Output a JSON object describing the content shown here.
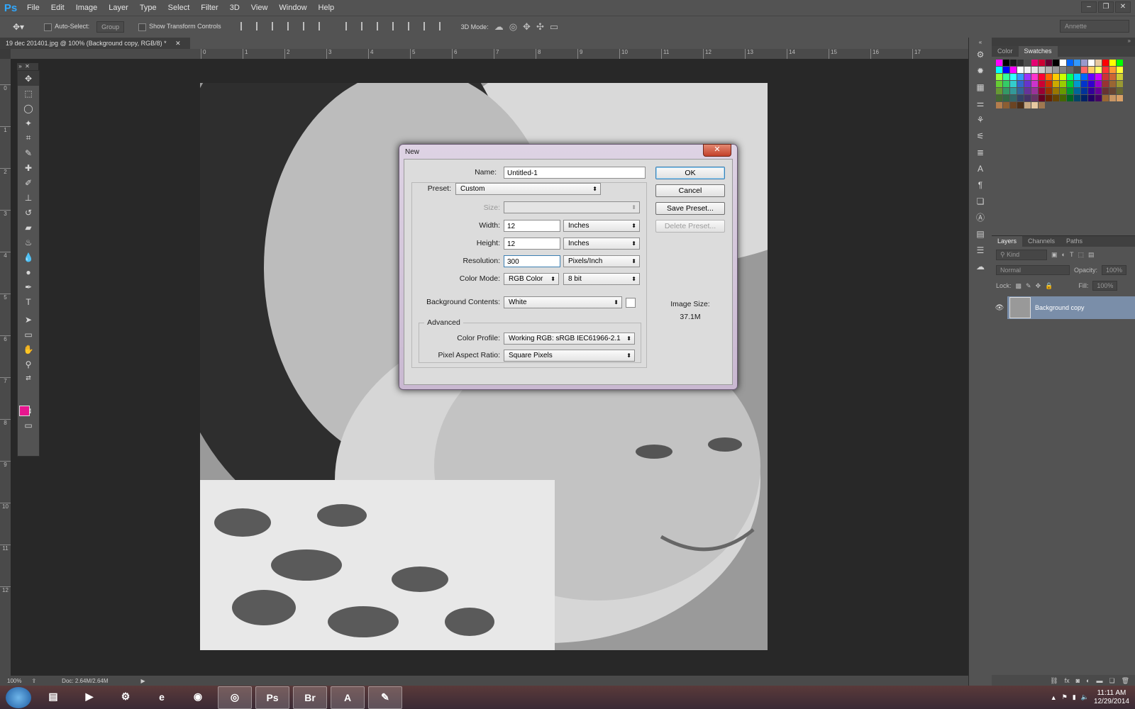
{
  "app": {
    "logo": "Ps"
  },
  "menu": [
    "File",
    "Edit",
    "Image",
    "Layer",
    "Type",
    "Select",
    "Filter",
    "3D",
    "View",
    "Window",
    "Help"
  ],
  "options": {
    "auto_select": "Auto-Select:",
    "auto_select_value": "Group",
    "show_transform": "Show Transform Controls",
    "mode_3d": "3D Mode:",
    "workspace": "Annette"
  },
  "document": {
    "tab_title": "19 dec 201401.jpg @ 100% (Background copy, RGB/8) *"
  },
  "ruler": {
    "h": [
      "0",
      "1",
      "2",
      "3",
      "4",
      "5",
      "6",
      "7",
      "8",
      "9",
      "10",
      "11",
      "12",
      "13",
      "14",
      "15",
      "16",
      "17"
    ],
    "v": [
      "0",
      "1",
      "2",
      "3",
      "4",
      "5",
      "6",
      "7",
      "8",
      "9",
      "10",
      "11",
      "12"
    ]
  },
  "status": {
    "zoom": "100%",
    "doc": "Doc: 2.64M/2.64M"
  },
  "tools": [
    {
      "icon": "move-icon",
      "glyph": "✥"
    },
    {
      "icon": "marquee-icon",
      "glyph": "⬚"
    },
    {
      "icon": "lasso-icon",
      "glyph": "◯"
    },
    {
      "icon": "quick-select-icon",
      "glyph": "✦"
    },
    {
      "icon": "crop-icon",
      "glyph": "⌗"
    },
    {
      "icon": "eyedropper-icon",
      "glyph": "✎"
    },
    {
      "icon": "healing-brush-icon",
      "glyph": "✚"
    },
    {
      "icon": "brush-icon",
      "glyph": "✐"
    },
    {
      "icon": "clone-stamp-icon",
      "glyph": "⊥"
    },
    {
      "icon": "history-brush-icon",
      "glyph": "↺"
    },
    {
      "icon": "eraser-icon",
      "glyph": "▰"
    },
    {
      "icon": "paint-bucket-icon",
      "glyph": "♨"
    },
    {
      "icon": "blur-icon",
      "glyph": "💧"
    },
    {
      "icon": "dodge-icon",
      "glyph": "●"
    },
    {
      "icon": "pen-icon",
      "glyph": "✒"
    },
    {
      "icon": "type-icon",
      "glyph": "T"
    },
    {
      "icon": "path-select-icon",
      "glyph": "➤"
    },
    {
      "icon": "rectangle-icon",
      "glyph": "▭"
    },
    {
      "icon": "hand-icon",
      "glyph": "✋"
    },
    {
      "icon": "zoom-icon",
      "glyph": "⚲"
    }
  ],
  "colors": {
    "foreground": "#e8168f",
    "background": "#ffffff"
  },
  "panels": {
    "color_tabs": [
      "Color",
      "Swatches"
    ],
    "layer_tabs": [
      "Layers",
      "Channels",
      "Paths"
    ],
    "kind": "Kind",
    "blend_mode": "Normal",
    "opacity_label": "Opacity:",
    "opacity_value": "100%",
    "lock_label": "Lock:",
    "fill_label": "Fill:",
    "fill_value": "100%",
    "layer_name": "Background copy"
  },
  "swatches": [
    "#ff00ff",
    "#000000",
    "#1a1a1a",
    "#333333",
    "#4d4d4d",
    "#e60073",
    "#cc0033",
    "#660033",
    "#000000",
    "#ffffff",
    "#0066ff",
    "#3399ff",
    "#9999cc",
    "#ffffff",
    "#e6c8a0",
    "#ff0000",
    "#ffff00",
    "#00ff00",
    "#00ffff",
    "#0000ff",
    "#ff00ff",
    "#ffffff",
    "#f2f2f2",
    "#e6e6e6",
    "#cccccc",
    "#b3b3b3",
    "#999999",
    "#808080",
    "#666666",
    "#4d4d4d",
    "#ff6666",
    "#ffcc66",
    "#ffff66",
    "#ff3333",
    "#ff9933",
    "#ffff33",
    "#99ff33",
    "#33ff99",
    "#33ffff",
    "#3399ff",
    "#9933ff",
    "#ff33cc",
    "#ff0033",
    "#ff6600",
    "#ffcc00",
    "#ccff00",
    "#00ff66",
    "#00ccff",
    "#0066ff",
    "#6600ff",
    "#cc00ff",
    "#cc3333",
    "#cc6633",
    "#cccc33",
    "#66cc33",
    "#33cc66",
    "#33cccc",
    "#3366cc",
    "#6633cc",
    "#cc33cc",
    "#cc0033",
    "#cc3300",
    "#ccaa00",
    "#99cc00",
    "#00cc33",
    "#0099cc",
    "#0033cc",
    "#3300cc",
    "#9900cc",
    "#993333",
    "#996633",
    "#999933",
    "#669933",
    "#339966",
    "#339999",
    "#336699",
    "#663399",
    "#993399",
    "#990033",
    "#993300",
    "#997700",
    "#669900",
    "#009933",
    "#006699",
    "#003399",
    "#330099",
    "#660099",
    "#663333",
    "#664433",
    "#666633",
    "#446633",
    "#336644",
    "#336666",
    "#334466",
    "#443366",
    "#663366",
    "#660022",
    "#662200",
    "#664400",
    "#446600",
    "#006622",
    "#004466",
    "#002266",
    "#220066",
    "#440066",
    "#996633",
    "#c89664",
    "#d9a066",
    "#b37d4d",
    "#8c5e33",
    "#6b4423",
    "#4d2f18",
    "#c8a882",
    "#e6c8a0",
    "#a07850"
  ],
  "dialog": {
    "title": "New",
    "close": "✕",
    "name_label": "Name:",
    "name_value": "Untitled-1",
    "preset_label": "Preset:",
    "preset_value": "Custom",
    "size_label": "Size:",
    "width_label": "Width:",
    "width_value": "12",
    "width_unit": "Inches",
    "height_label": "Height:",
    "height_value": "12",
    "height_unit": "Inches",
    "resolution_label": "Resolution:",
    "resolution_value": "300",
    "resolution_unit": "Pixels/Inch",
    "color_mode_label": "Color Mode:",
    "color_mode_value": "RGB Color",
    "bit_depth_value": "8 bit",
    "bg_contents_label": "Background Contents:",
    "bg_contents_value": "White",
    "advanced_label": "Advanced",
    "color_profile_label": "Color Profile:",
    "color_profile_value": "Working RGB:  sRGB IEC61966-2.1",
    "pixel_aspect_label": "Pixel Aspect Ratio:",
    "pixel_aspect_value": "Square Pixels",
    "ok": "OK",
    "cancel": "Cancel",
    "save_preset": "Save Preset...",
    "delete_preset": "Delete Preset...",
    "image_size_label": "Image Size:",
    "image_size_value": "37.1M"
  },
  "taskbar": {
    "apps": [
      {
        "name": "explorer-icon",
        "glyph": "▤"
      },
      {
        "name": "media-player-icon",
        "glyph": "▶"
      },
      {
        "name": "steam-icon",
        "glyph": "⚙"
      },
      {
        "name": "internet-explorer-icon",
        "glyph": "e"
      },
      {
        "name": "firefox-icon",
        "glyph": "◉"
      },
      {
        "name": "chrome-icon",
        "glyph": "◎"
      },
      {
        "name": "photoshop-icon",
        "glyph": "Ps"
      },
      {
        "name": "bridge-icon",
        "glyph": "Br"
      },
      {
        "name": "acrobat-icon",
        "glyph": "A"
      },
      {
        "name": "paint-icon",
        "glyph": "✎"
      }
    ],
    "time": "11:11 AM",
    "date": "12/29/2014"
  }
}
